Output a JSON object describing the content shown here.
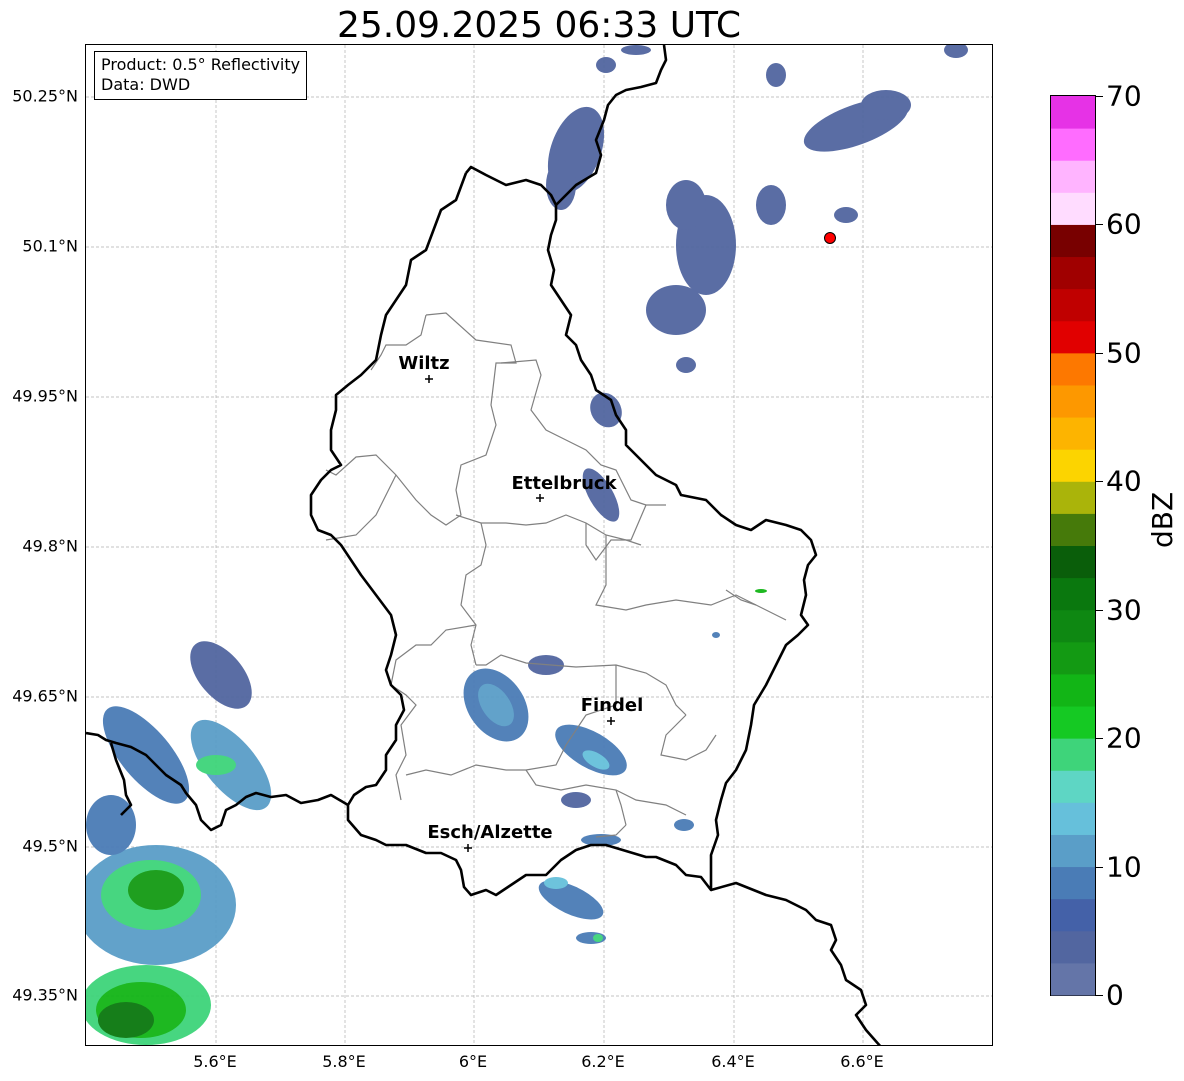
{
  "title": "25.09.2025 06:33 UTC",
  "info_box": {
    "product": "Product: 0.5° Reflectivity",
    "data_source": "Data: DWD"
  },
  "map": {
    "lat_ticks": [
      "50.25°N",
      "50.1°N",
      "49.95°N",
      "49.8°N",
      "49.65°N",
      "49.5°N",
      "49.35°N"
    ],
    "lon_ticks": [
      "5.6°E",
      "5.8°E",
      "6°E",
      "6.2°E",
      "6.4°E",
      "6.6°E"
    ],
    "places": [
      {
        "name": "Wiltz"
      },
      {
        "name": "Ettelbruck"
      },
      {
        "name": "Findel"
      },
      {
        "name": "Esch/Alzette"
      }
    ],
    "radar_site_marker_color": "#ff0000",
    "grid": true,
    "border_color": "#000000",
    "canton_line_color": "#808080"
  },
  "colorbar": {
    "label": "dBZ",
    "min": 0,
    "max": 70,
    "step": 2.5,
    "tick_labels": [
      "0",
      "10",
      "20",
      "30",
      "40",
      "50",
      "60",
      "70"
    ],
    "colors": [
      "#6475a8",
      "#5266a0",
      "#4461a8",
      "#4a7cb6",
      "#5a9ec8",
      "#66c0db",
      "#5ed6c4",
      "#3ed47a",
      "#15c923",
      "#12b516",
      "#139a13",
      "#0e8812",
      "#0a780e",
      "#0a5e0a",
      "#467a0a",
      "#aab40a",
      "#fcd400",
      "#fdb400",
      "#fd9800",
      "#fd7800",
      "#e10000",
      "#c00000",
      "#a00000",
      "#780000",
      "#ffdcff",
      "#ffb4ff",
      "#ff6cff",
      "#e632e6"
    ]
  }
}
